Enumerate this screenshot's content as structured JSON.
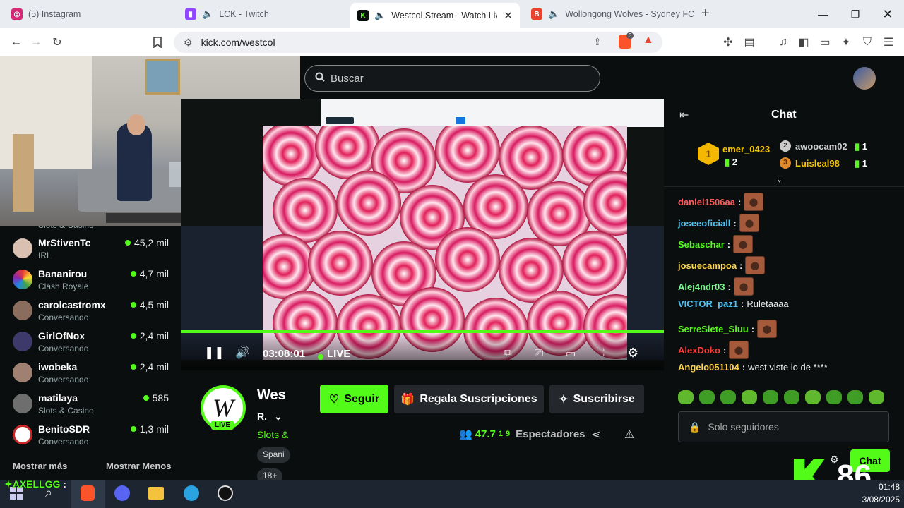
{
  "browser": {
    "tabs": [
      {
        "title": "(5) Instagram",
        "icon": "instagram-icon",
        "color": "#d62976"
      },
      {
        "title": "LCK - Twitch",
        "icon": "twitch-icon",
        "color": "#9146ff"
      },
      {
        "title": "Westcol Stream - Watch Live o",
        "icon": "kick-icon",
        "color": "#53fc18"
      },
      {
        "title": "Wollongong Wolves - Sydney FC",
        "icon": "brave-icon",
        "color": "#e8412c"
      }
    ],
    "new_tab": "+",
    "url": "kick.com/westcol",
    "brave_badge": "3"
  },
  "search": {
    "placeholder": "Buscar"
  },
  "sidebar": {
    "partial_category": "Slots & Casino",
    "channels": [
      {
        "name": "MrStivenTc",
        "category": "IRL",
        "viewers": "45,2 mil"
      },
      {
        "name": "Bananirou",
        "category": "Clash Royale",
        "viewers": "4,7 mil"
      },
      {
        "name": "carolcastromx",
        "category": "Conversando",
        "viewers": "4,5 mil"
      },
      {
        "name": "GirlOfNox",
        "category": "Conversando",
        "viewers": "2,4 mil"
      },
      {
        "name": "iwobeka",
        "category": "Conversando",
        "viewers": "2,4 mil"
      },
      {
        "name": "matilaya",
        "category": "Slots & Casino",
        "viewers": "585"
      },
      {
        "name": "BenitoSDR",
        "category": "Conversando",
        "viewers": "1,3 mil"
      }
    ],
    "show_more": "Mostrar más",
    "show_less": "Mostrar Menos"
  },
  "player": {
    "time": "03:08:01",
    "live_label": "LIVE",
    "progress": 1.0
  },
  "channel": {
    "name": "Wes",
    "subtitle": "R.",
    "category": "Slots &",
    "tag_language": "Spani",
    "tag_age": "18+",
    "live_badge": "LIVE",
    "follow_label": "Seguir",
    "gift_label": "Regala Suscripciones",
    "subscribe_label": "Suscribirse",
    "viewers_count": "47.7",
    "viewers_sup": "1",
    "viewers_sub": "9",
    "viewers_label": "Espectadores"
  },
  "chat": {
    "title": "Chat",
    "leaderboard": [
      {
        "rank": "1",
        "name": "emer_0423",
        "count": "2"
      },
      {
        "rank": "2",
        "name": "awoocam02",
        "count": "1"
      },
      {
        "rank": "3",
        "name": "Luisleal98",
        "count": "1"
      }
    ],
    "messages": [
      {
        "user": "daniel1506aa",
        "color": "#ff5a5a",
        "text": "",
        "emote": true
      },
      {
        "user": "joseeoficiall",
        "color": "#4fc3f7",
        "text": "",
        "emote": true
      },
      {
        "user": "Sebaschar",
        "color": "#53fc18",
        "text": "",
        "emote": true
      },
      {
        "user": "josuecampoa",
        "color": "#ffd54f",
        "text": "",
        "emote": true
      },
      {
        "user": "Alej4ndr03",
        "color": "#7cfc90",
        "text": "",
        "emote": true
      },
      {
        "user": "VICTOR_paz1",
        "color": "#4fc3f7",
        "text": "Ruletaaaa",
        "emote": false
      },
      {
        "user": "SerreSiete_Siuu",
        "color": "#53fc18",
        "text": "",
        "emote": true
      },
      {
        "user": "AlexDoko",
        "color": "#ff3b3b",
        "text": "",
        "emote": true
      },
      {
        "user": "Angelo051104",
        "color": "#ffd54f",
        "text": "west viste lo de ****",
        "emote": false
      }
    ],
    "input_placeholder": "Solo seguidores",
    "send_label": "Chat"
  },
  "overlay": {
    "kick_count": "86",
    "viewer_name": "AXELLGG",
    "clock_time": "01:48",
    "clock_date": "3/08/2025"
  }
}
